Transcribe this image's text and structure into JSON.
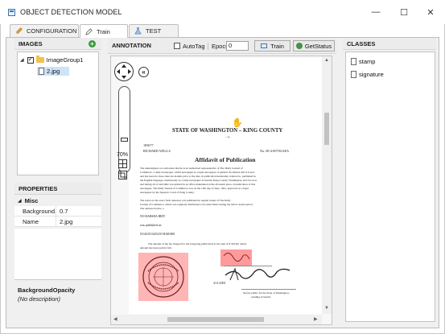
{
  "window": {
    "title": "OBJECT DETECTION MODEL",
    "controls": {
      "minimize": "—",
      "maximize": "☐",
      "close": "✕"
    }
  },
  "tabs": [
    {
      "label": "CONFIGURATION",
      "icon": "wrench-icon"
    },
    {
      "label": "Train",
      "icon": "pen-icon",
      "active": true
    },
    {
      "label": "TEST",
      "icon": "flask-icon"
    }
  ],
  "images_panel": {
    "header": "IMAGES",
    "add_icon": "plus-icon",
    "tree": {
      "expander": "◢",
      "group": "ImageGroup1",
      "files": [
        "2.jpg"
      ]
    }
  },
  "properties_panel": {
    "header": "PROPERTIES",
    "category": "Misc",
    "rows": [
      {
        "key": "Background...",
        "value": "0.7"
      },
      {
        "key": "Name",
        "value": "2.jpg"
      }
    ],
    "description_title": "BackgroundOpacity",
    "description_text": "(No description)"
  },
  "annotation_panel": {
    "header": "ANNOTATION",
    "autotag_label": "AutoTag",
    "epochs_label": "Epocs",
    "epochs_value": "0",
    "train_button": "Train",
    "getstatus_button": "GetStatus",
    "zoom_level": "70%"
  },
  "classes_panel": {
    "header": "CLASSES",
    "items": [
      "stamp",
      "signature"
    ]
  },
  "document": {
    "heading": "STATE OF WASHINGTON – KING COUNTY",
    "subheading": "– ss.",
    "number_left": "183677",
    "name_left": "RICHARD WELLS",
    "number_right": "No. 69-4-00794-SEA",
    "title": "Affidavit of Publication",
    "para1_lines": [
      "The undersigned, on oath states that he is an authorized representative of The Daily Journal of",
      "Commerce, a daily newspaper, which newspaper is a legal newspaper of general circulation and it is now",
      "and has been for more than six months prior to the date of publication hereinafter referred to, published in",
      "the English language continuously as a daily newspaper in Seattle, King County, Washington, and it is now",
      "and during all of said time was printed in an office maintained at the aforesaid place of publication of this",
      "newspaper. The Daily Journal of Commerce was on the 12th day of June, 1941, approved as a legal",
      "newspaper by the Superior Court of King County."
    ],
    "para2_lines": [
      "The notice in the exact form annexed, was published in regular issues of The Daily",
      "Journal of Commerce, which was regularly distributed to its subscribers during the below stated period.",
      "The annexed notice, a"
    ],
    "line_a": "NO BARSHA BRIT",
    "line_b": "was published on",
    "line_c": "03/26/03 04/02/03 BARSHI",
    "para3": "The amount of the fee charged for the foregoing publication is the sum of $ 303.00, which",
    "para3b": "amount has been paid in full.",
    "date": "4/11/2003",
    "notary_lines": [
      "Notary public for the State of Washington,",
      "residing in Seattle"
    ],
    "seal_text": "RICHARD WELLS NOTARY PUBLIC STATE OF WASHINGTON"
  },
  "colors": {
    "annotation_red": "#ff8a8a",
    "selection_blue": "#cde3f7",
    "add_green": "#3a9b3a"
  }
}
